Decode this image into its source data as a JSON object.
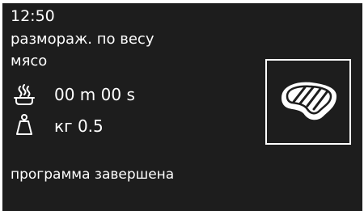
{
  "status_bar": {
    "clock": "12:50"
  },
  "program": {
    "name": "размораж. по весу",
    "food": "мясо"
  },
  "timer": {
    "icon": "steam-pot-icon",
    "value": "00 m 00 s"
  },
  "weight": {
    "icon": "weight-icon",
    "value": "кг 0.5"
  },
  "food_image": {
    "icon": "steak-icon"
  },
  "message": {
    "text": "программа завершена"
  },
  "colors": {
    "background": "#1d1d1d",
    "foreground": "#ffffff"
  }
}
